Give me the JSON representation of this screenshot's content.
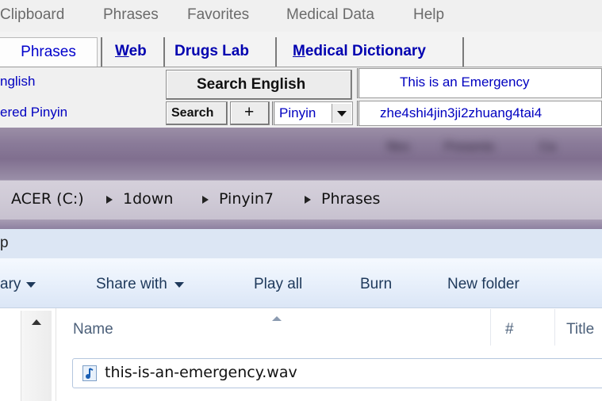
{
  "menubar": {
    "items": [
      "Clipboard",
      "Phrases",
      "Favorites",
      "Medical Data",
      "Help"
    ]
  },
  "tabs": {
    "phrases": "Phrases",
    "web_prefix": "W",
    "web_rest": "eb",
    "drugs_lab": "Drugs Lab",
    "medical_prefix": "M",
    "medical_rest": "edical Dictionary"
  },
  "search_rows": {
    "english_label": "nglish",
    "search_english_button": "Search English",
    "english_result": "This is an Emergency",
    "pinyin_label": "ered Pinyin",
    "search_button": "Search",
    "plus_button": "+",
    "pinyin_select": "Pinyin",
    "pinyin_result": "zhe4shi4jin3ji2zhuang4tai4"
  },
  "explorer": {
    "aero_blurred": [
      "files",
      "Presents",
      "Ca"
    ],
    "breadcrumb": [
      "ACER (C:)",
      "1down",
      "Pinyin7",
      "Phrases"
    ],
    "title_partial": "p",
    "commands": {
      "library": "ary",
      "share_with": "Share with",
      "play_all": "Play all",
      "burn": "Burn",
      "new_folder": "New folder"
    },
    "columns": [
      "Name",
      "#",
      "Title"
    ],
    "files": [
      "this-is-an-emergency.wav"
    ]
  },
  "icons": {
    "audio_file": "music-note-icon",
    "chevron": "chevron-down-icon",
    "breadcrumb_sep": "triangle-right-icon"
  }
}
